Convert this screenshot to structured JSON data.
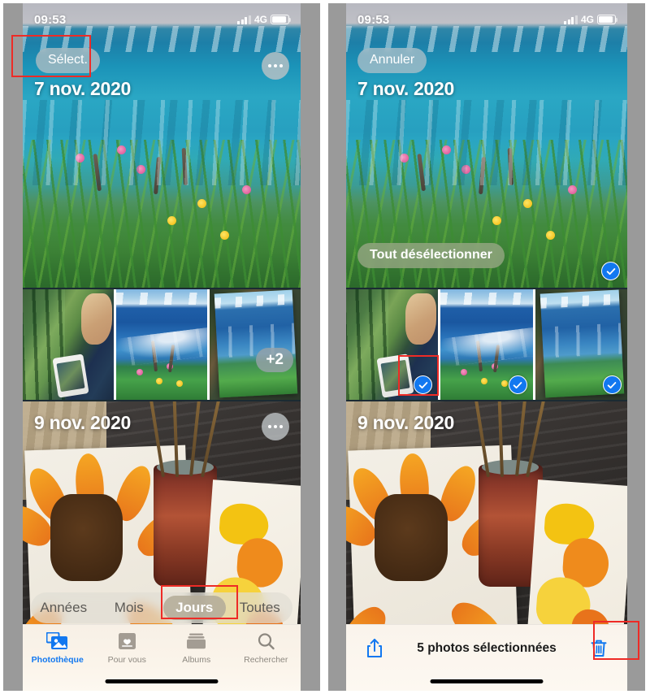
{
  "meta": {
    "app": "Photos (iOS)",
    "language": "fr"
  },
  "status_bar": {
    "time": "09:53",
    "network": "4G",
    "signal_bars": 4,
    "battery_level": "88%"
  },
  "colors": {
    "accent_blue": "#1278f0",
    "annotation_red": "#ee2b26",
    "pill_bg": "rgba(175,190,195,.78)",
    "active_segment": "rgba(180,172,152,.88)"
  },
  "panels": {
    "left": {
      "name": "browse-mode",
      "section_1": {
        "date": "7 nov. 2020",
        "select_button": "Sélect.",
        "more_button_icon": "ellipsis-icon"
      },
      "thumbnails": {
        "count_badge": "+2",
        "items": [
          {
            "name": "studio-painter-thumbnail",
            "selected": false
          },
          {
            "name": "wave-canvas-thumbnail",
            "selected": false
          },
          {
            "name": "held-canvas-thumbnail",
            "selected": false
          }
        ]
      },
      "section_2": {
        "date": "9 nov. 2020",
        "more_button_icon": "ellipsis-icon"
      },
      "segmented_control": {
        "options": [
          "Années",
          "Mois",
          "Jours",
          "Toutes"
        ],
        "selected": "Jours"
      },
      "tab_bar": {
        "items": [
          {
            "label": "Photothèque",
            "icon": "photos-library-icon",
            "active": true
          },
          {
            "label": "Pour vous",
            "icon": "for-you-heart-icon",
            "active": false
          },
          {
            "label": "Albums",
            "icon": "albums-folder-icon",
            "active": false
          },
          {
            "label": "Rechercher",
            "icon": "search-icon",
            "active": false
          }
        ]
      }
    },
    "right": {
      "name": "selection-mode",
      "section_1": {
        "date": "7 nov. 2020",
        "cancel_button": "Annuler",
        "deselect_all_button": "Tout désélectionner",
        "hero_selected": true
      },
      "thumbnails": {
        "items": [
          {
            "name": "studio-painter-thumbnail",
            "selected": true
          },
          {
            "name": "wave-canvas-thumbnail",
            "selected": true
          },
          {
            "name": "held-canvas-thumbnail",
            "selected": true
          }
        ]
      },
      "section_2": {
        "date": "9 nov. 2020"
      },
      "selection_toolbar": {
        "share_icon": "share-upload-icon",
        "count_label": "5 photos sélectionnées",
        "delete_icon": "trash-icon"
      }
    }
  },
  "annotations": [
    {
      "id": "select-button-highlight",
      "target": "Sélect."
    },
    {
      "id": "thumbnail-checkmark-highlight",
      "target": "checkmark on first thumbnail"
    },
    {
      "id": "jours-segment-highlight",
      "target": "Jours"
    },
    {
      "id": "trash-button-highlight",
      "target": "trash-icon"
    }
  ]
}
